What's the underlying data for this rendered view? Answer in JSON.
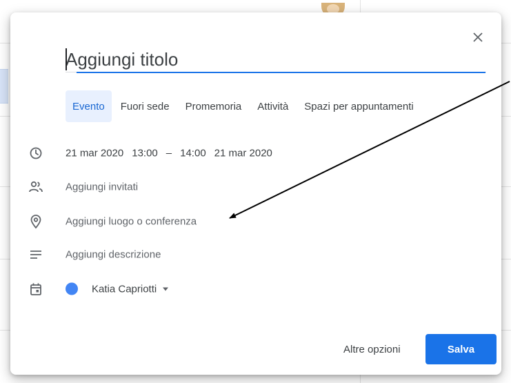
{
  "dialog": {
    "title_placeholder": "Aggiungi titolo",
    "tabs": [
      {
        "label": "Evento",
        "active": true
      },
      {
        "label": "Fuori sede",
        "active": false
      },
      {
        "label": "Promemoria",
        "active": false
      },
      {
        "label": "Attività",
        "active": false
      },
      {
        "label": "Spazi per appuntamenti",
        "active": false
      }
    ],
    "datetime": {
      "start_date": "21 mar 2020",
      "start_time": "13:00",
      "separator": "–",
      "end_time": "14:00",
      "end_date": "21 mar 2020"
    },
    "guests_label": "Aggiungi invitati",
    "location_label": "Aggiungi luogo o conferenza",
    "description_label": "Aggiungi descrizione",
    "calendar": {
      "name": "Katia Capriotti",
      "color": "#4285f4"
    },
    "more_options_label": "Altre opzioni",
    "save_label": "Salva"
  },
  "colors": {
    "accent": "#1a73e8",
    "active_tab_bg": "#e8f0fe",
    "text_primary": "#3c4043",
    "text_secondary": "#5f6368"
  },
  "icons": {
    "close": "close-icon",
    "time": "clock-icon",
    "guests": "people-icon",
    "location": "location-pin-icon",
    "description": "text-lines-icon",
    "calendar": "calendar-icon",
    "dropdown": "caret-down-icon"
  }
}
